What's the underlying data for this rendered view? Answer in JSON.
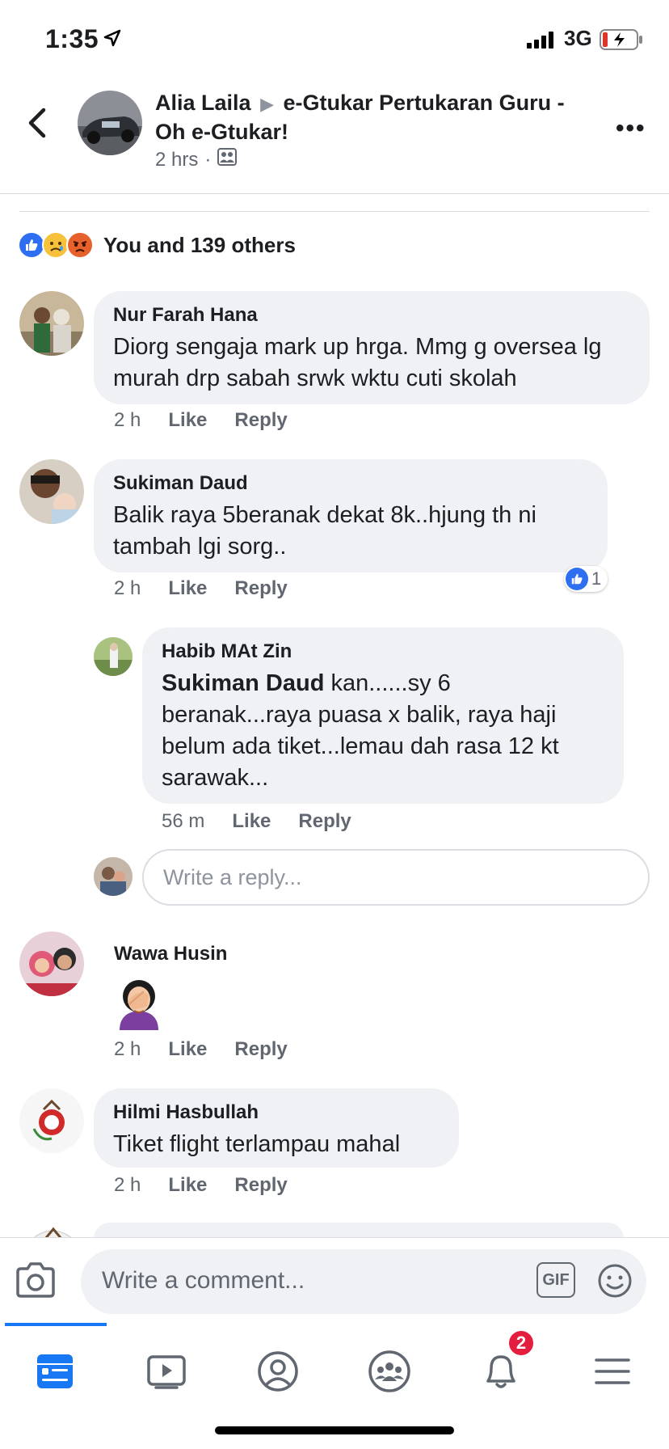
{
  "status_bar": {
    "time": "1:35",
    "network": "3G"
  },
  "header": {
    "author": "Alia Laila",
    "group": "e-Gtukar Pertukaran Guru - Oh e-Gtukar!",
    "time": "2 hrs",
    "separator": "·"
  },
  "reactions": {
    "summary": "You and 139 others"
  },
  "comments": [
    {
      "name": "Nur Farah Hana",
      "text": "Diorg sengaja mark up hrga. Mmg g oversea lg murah drp sabah srwk wktu cuti skolah",
      "time": "2 h",
      "like": "Like",
      "reply": "Reply"
    },
    {
      "name": "Sukiman Daud",
      "text": "Balik raya 5beranak dekat 8k..hjung th ni tambah lgi sorg..",
      "time": "2 h",
      "like": "Like",
      "reply": "Reply",
      "like_count": "1"
    },
    {
      "name": "Habib MAt Zin",
      "mention": "Sukiman Daud",
      "text": " kan......sy 6 beranak...raya puasa x balik, raya haji belum ada tiket...lemau dah rasa 12 kt sarawak...",
      "time": "56 m",
      "like": "Like",
      "reply": "Reply"
    },
    {
      "name": "Wawa Husin",
      "text": "",
      "emoji": "facepalm-woman",
      "time": "2 h",
      "like": "Like",
      "reply": "Reply"
    },
    {
      "name": "Hilmi Hasbullah",
      "text": "Tiket flight terlampau mahal",
      "time": "2 h",
      "like": "Like",
      "reply": "Reply"
    }
  ],
  "reply_box": {
    "placeholder": "Write a reply..."
  },
  "composer": {
    "placeholder": "Write a comment...",
    "gif_label": "GIF"
  },
  "tabbar": {
    "tabs": [
      "home",
      "watch",
      "profile",
      "groups",
      "notifications",
      "menu"
    ],
    "active": "home",
    "notification_count": "2"
  },
  "colors": {
    "accent": "#1877f2",
    "bubble": "#eff1f4",
    "muted": "#606770",
    "badge": "#e41e3f"
  }
}
